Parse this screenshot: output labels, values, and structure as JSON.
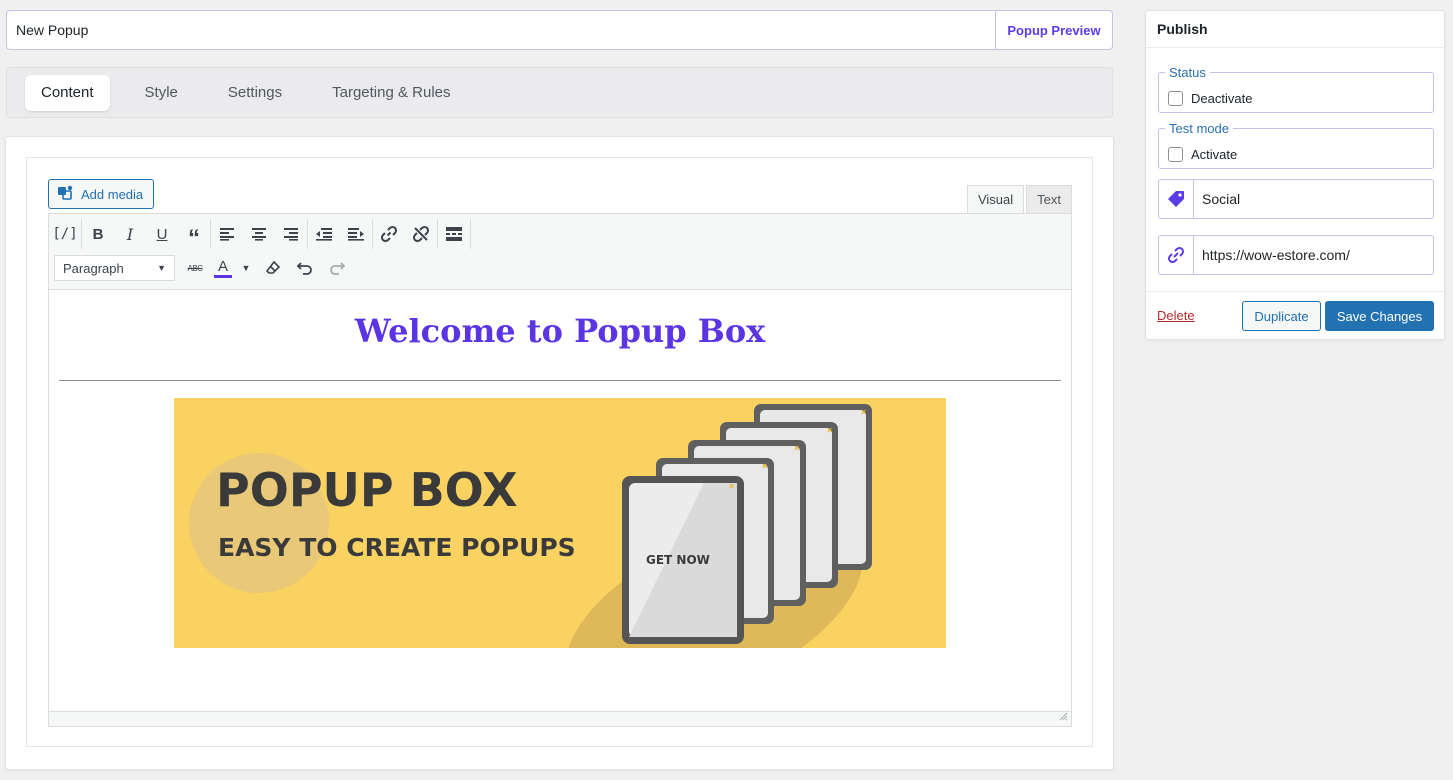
{
  "header": {
    "title_value": "New Popup",
    "preview_label": "Popup Preview"
  },
  "tabs": [
    {
      "label": "Content",
      "active": true
    },
    {
      "label": "Style",
      "active": false
    },
    {
      "label": "Settings",
      "active": false
    },
    {
      "label": "Targeting & Rules",
      "active": false
    }
  ],
  "editor": {
    "add_media_label": "Add media",
    "modes": [
      {
        "label": "Visual",
        "active": true
      },
      {
        "label": "Text",
        "active": false
      }
    ],
    "format_select_value": "Paragraph",
    "toolbar_row1_icons": [
      "shortcode-icon",
      "bold-icon",
      "italic-icon",
      "underline-icon",
      "blockquote-icon",
      "align-left-icon",
      "align-center-icon",
      "align-right-icon",
      "outdent-icon",
      "indent-icon",
      "link-icon",
      "unlink-icon",
      "read-more-icon"
    ],
    "toolbar_row2_icons": [
      "strikethrough-icon",
      "text-color-icon",
      "clear-formatting-icon",
      "undo-icon",
      "redo-icon"
    ],
    "content": {
      "heading": "Welcome to Popup Box",
      "heading_color": "#5b34e3",
      "banner": {
        "title": "POPUP BOX",
        "subtitle": "EASY TO CREATE POPUPS",
        "cta": "GET NOW",
        "bg_color": "#f9d262"
      }
    }
  },
  "publish": {
    "title": "Publish",
    "status": {
      "legend": "Status",
      "checkbox_label": "Deactivate",
      "checked": false
    },
    "test_mode": {
      "legend": "Test mode",
      "checkbox_label": "Activate",
      "checked": false
    },
    "tag_value": "Social",
    "url_value": "https://wow-estore.com/",
    "delete_label": "Delete",
    "duplicate_label": "Duplicate",
    "save_label": "Save Changes"
  },
  "colors": {
    "accent": "#5b3de6",
    "wp_blue": "#2271b1",
    "delete_red": "#b32d2e"
  }
}
